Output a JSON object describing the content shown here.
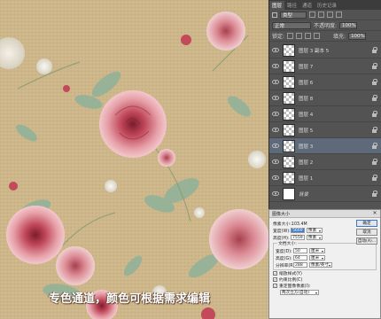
{
  "caption": "专色通道，颜色可根据需求编辑",
  "layers_panel": {
    "tabs": [
      "图层",
      "路径",
      "通道",
      "历史记录"
    ],
    "filter_kind": "类型",
    "blend_mode": "正常",
    "opacity_label": "不透明度:",
    "opacity_value": "100%",
    "lock_label": "锁定:",
    "fill_label": "填充:",
    "fill_value": "100%",
    "layers": [
      {
        "name": "图层 3 副本 5",
        "selected": false,
        "thumb": "check",
        "locked": true
      },
      {
        "name": "图层 7",
        "selected": false,
        "thumb": "check",
        "locked": true
      },
      {
        "name": "图层 6",
        "selected": false,
        "thumb": "check",
        "locked": true
      },
      {
        "name": "图层 8",
        "selected": false,
        "thumb": "check",
        "locked": true
      },
      {
        "name": "图层 4",
        "selected": false,
        "thumb": "check",
        "locked": true
      },
      {
        "name": "图层 5",
        "selected": false,
        "thumb": "check",
        "locked": true
      },
      {
        "name": "图层 3",
        "selected": true,
        "thumb": "check",
        "locked": true
      },
      {
        "name": "图层 2",
        "selected": false,
        "thumb": "check",
        "locked": true
      },
      {
        "name": "图层 1",
        "selected": false,
        "thumb": "check",
        "locked": true
      },
      {
        "name": "背景",
        "selected": false,
        "thumb": "white",
        "locked": true,
        "italic": true
      }
    ]
  },
  "image_size_dialog": {
    "title": "图像大小",
    "pixel_dims_label": "像素大小:103.4M",
    "width_label": "宽度(W):",
    "width_value": "5669",
    "height_label": "高度(H):",
    "height_value": "7559",
    "pixel_unit": "像素",
    "doc_size_label": "文档大小:",
    "doc_width_label": "宽度(D):",
    "doc_width_value": "50",
    "doc_height_label": "高度(G):",
    "doc_height_value": "64",
    "cm_unit": "厘米",
    "resolution_label": "分辨率(R):",
    "resolution_value": "288",
    "resolution_unit": "像素/英寸",
    "buttons": {
      "ok": "确定",
      "cancel": "取消",
      "auto": "自动(A)..."
    },
    "checkboxes": [
      "缩放样式(Y)",
      "约束比例(C)",
      "重定图像像素(I):"
    ],
    "resample_method": "两次立方(自动)"
  },
  "colors": {
    "canvas_bg": "#cdb78a",
    "rose_dark": "#b8384a",
    "rose_light": "#e6a0a8",
    "leaf": "#8fb29a",
    "panel_bg": "#535353",
    "selected_layer": "#5e6a7a"
  }
}
